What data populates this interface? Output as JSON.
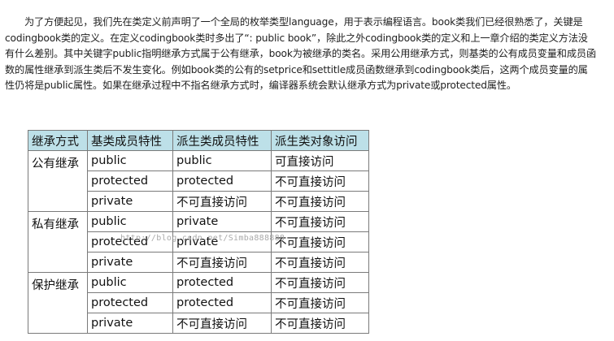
{
  "paragraph": "为了方便起见，我们先在类定义前声明了一个全局的枚举类型language，用于表示编程语言。book类我们已经很熟悉了，关键是codingbook类的定义。在定义codingbook类时多出了“: public book”，除此之外codingbook类的定义和上一章介绍的类定义方法没有什么差别。其中关键字public指明继承方式属于公有继承，book为被继承的类名。采用公用继承方式，则基类的公有成员变量和成员函数的属性继承到派生类后不发生变化。例如book类的公有的setprice和settitle成员函数继承到codingbook类后，这两个成员变量的属性仍将是public属性。如果在继承过程中不指名继承方式时，编译器系统会默认继承方式为private或protected属性。",
  "table": {
    "headers": [
      "继承方式",
      "基类成员特性",
      "派生类成员特性",
      "派生类对象访问"
    ],
    "groups": [
      {
        "mode": "公有继承",
        "rows": [
          [
            "public",
            "public",
            "可直接访问"
          ],
          [
            "protected",
            "protected",
            "不可直接访问"
          ],
          [
            "private",
            "不可直接访问",
            "不可直接访问"
          ]
        ]
      },
      {
        "mode": "私有继承",
        "rows": [
          [
            "public",
            "private",
            "不可直接访问"
          ],
          [
            "protected",
            "private",
            "不可直接访问"
          ],
          [
            "private",
            "不可直接访问",
            "不可直接访问"
          ]
        ]
      },
      {
        "mode": "保护继承",
        "rows": [
          [
            "public",
            "protected",
            "不可直接访问"
          ],
          [
            "protected",
            "protected",
            "不可直接访问"
          ],
          [
            "private",
            "不可直接访问",
            "不可直接访问"
          ]
        ]
      }
    ],
    "header_color": "#bde0e8"
  },
  "watermark": "http://blog.csdn.net/Simba888888"
}
